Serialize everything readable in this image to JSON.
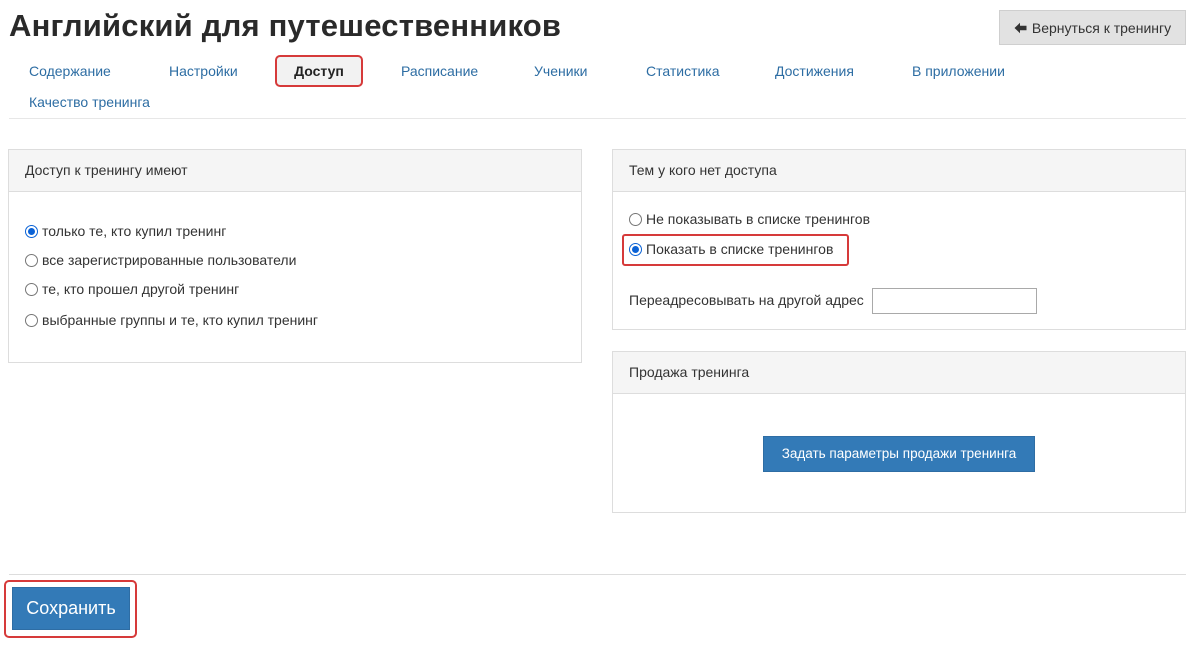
{
  "header": {
    "title": "Английский для путешественников",
    "back_button_label": "Вернуться к тренингу",
    "back_icon": "arrow-left-icon"
  },
  "tabs": [
    {
      "label": "Содержание",
      "active": false
    },
    {
      "label": "Настройки",
      "active": false
    },
    {
      "label": "Доступ",
      "active": true
    },
    {
      "label": "Расписание",
      "active": false
    },
    {
      "label": "Ученики",
      "active": false
    },
    {
      "label": "Статистика",
      "active": false
    },
    {
      "label": "Достижения",
      "active": false
    },
    {
      "label": "В приложении",
      "active": false
    },
    {
      "label": "Качество тренинга",
      "active": false
    }
  ],
  "access_panel": {
    "heading": "Доступ к тренингу имеют",
    "options": [
      {
        "label": "только те, кто купил тренинг",
        "checked": true
      },
      {
        "label": "все зарегистрированные пользователи",
        "checked": false
      },
      {
        "label": "те, кто прошел другой тренинг",
        "checked": false
      },
      {
        "label": "выбранные группы и те, кто купил тренинг",
        "checked": false
      }
    ]
  },
  "no_access_panel": {
    "heading": "Тем у кого нет доступа",
    "options": [
      {
        "label": "Не показывать в списке тренингов",
        "checked": false
      },
      {
        "label": "Показать в списке тренингов",
        "checked": true
      }
    ],
    "redirect_label": "Переадресовывать на другой адрес",
    "redirect_value": ""
  },
  "sale_panel": {
    "heading": "Продажа тренинга",
    "button_label": "Задать параметры продажи тренинга"
  },
  "footer": {
    "save_label": "Сохранить"
  },
  "colors": {
    "link": "#2d6da3",
    "primary": "#337ab7",
    "highlight": "#d63a3a",
    "radio_checked": "#0a62d6"
  }
}
